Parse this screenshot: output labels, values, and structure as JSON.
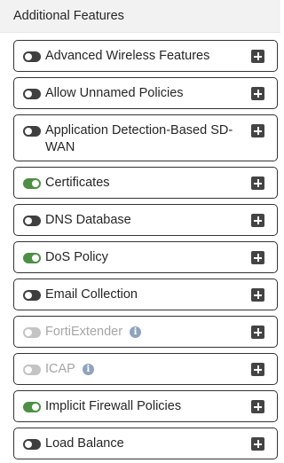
{
  "header": {
    "title": "Additional Features"
  },
  "features": [
    {
      "label": "Advanced Wireless Features",
      "state": "off"
    },
    {
      "label": "Allow Unnamed Policies",
      "state": "off"
    },
    {
      "label": "Application Detection-Based SD-WAN",
      "state": "off"
    },
    {
      "label": "Certificates",
      "state": "on"
    },
    {
      "label": "DNS Database",
      "state": "off"
    },
    {
      "label": "DoS Policy",
      "state": "on"
    },
    {
      "label": "Email Collection",
      "state": "off"
    },
    {
      "label": "FortiExtender",
      "state": "disabled",
      "info": "i"
    },
    {
      "label": "ICAP",
      "state": "disabled",
      "info": "i"
    },
    {
      "label": "Implicit Firewall Policies",
      "state": "on"
    },
    {
      "label": "Load Balance",
      "state": "off"
    }
  ],
  "icons": {
    "expand": "plus-square-icon",
    "info": "info-circle-icon"
  },
  "colors": {
    "toggle_on": "#4d8f45",
    "toggle_off": "#3f3f3f",
    "toggle_disabled": "#c4c4c4",
    "info": "#8fa3bd"
  }
}
